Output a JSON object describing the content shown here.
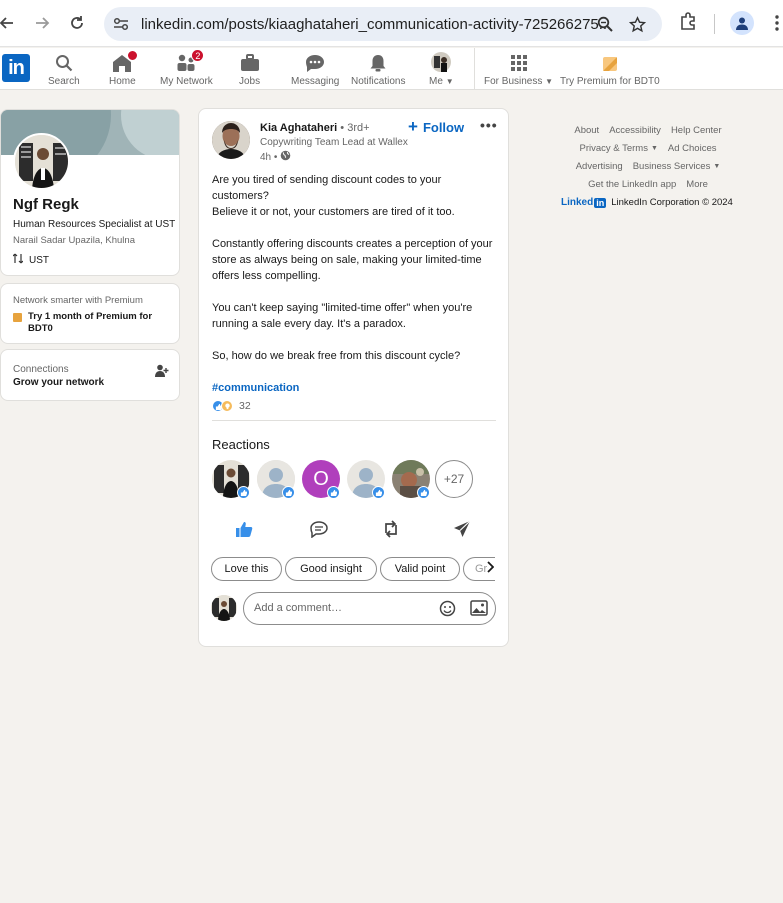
{
  "browser": {
    "url": "linkedin.com/posts/kiaaghataheri_communication-activity-725266275...",
    "icons": [
      "back-icon",
      "forward-icon",
      "reload-icon",
      "site-settings-icon",
      "zoom-icon",
      "star-icon",
      "extensions-icon",
      "profile-icon",
      "more-icon"
    ]
  },
  "nav": {
    "items": [
      {
        "label": "Search",
        "icon": "search-icon"
      },
      {
        "label": "Home",
        "icon": "home-icon"
      },
      {
        "label": "My Network",
        "icon": "network-icon",
        "badge": "2"
      },
      {
        "label": "Jobs",
        "icon": "briefcase-icon"
      },
      {
        "label": "Messaging",
        "icon": "messaging-icon"
      },
      {
        "label": "Notifications",
        "icon": "bell-icon"
      },
      {
        "label": "Me",
        "icon": "avatar"
      },
      {
        "label": "For Business",
        "icon": "grid-icon"
      },
      {
        "label": "Try Premium for BDT0",
        "icon": "premium-icon"
      }
    ]
  },
  "profile": {
    "name": "Ngf Regk",
    "title": "Human Resources Specialist at UST",
    "location": "Narail Sadar Upazila, Khulna",
    "org": "UST"
  },
  "premium": {
    "header": "Network smarter with Premium",
    "link": "Try 1 month of Premium for BDT0"
  },
  "connections": {
    "header": "Connections",
    "sub": "Grow your network"
  },
  "post": {
    "author": "Kia Aghataheri",
    "degree": "• 3rd+",
    "headline": "Copywriting Team Lead at Wallex",
    "time": "4h •",
    "follow": "Follow",
    "paragraphs": [
      "Are you tired of sending discount codes to your customers?\nBelieve it or not, your customers are tired of it too.",
      "Constantly offering discounts creates a perception of your store as always being on sale, making your limited-time offers less compelling.",
      "You can't keep saying \"limited-time offer\" when you're running a sale every day. It's a paradox.",
      "So, how do we break free from this discount cycle?"
    ],
    "hashtag": "#communication",
    "reaction_count": "32",
    "reactions_title": "Reactions",
    "more_reactors": "+27",
    "chips": [
      "Love this",
      "Good insight",
      "Valid point",
      "Gr"
    ],
    "comment_placeholder": "Add a comment…"
  },
  "footer": {
    "row1": [
      "About",
      "Accessibility",
      "Help Center"
    ],
    "row2": [
      "Privacy & Terms",
      "Ad Choices"
    ],
    "row3": [
      "Advertising",
      "Business Services"
    ],
    "row4": [
      "Get the LinkedIn app",
      "More"
    ],
    "brand_word": "Linked",
    "brand_in": "in",
    "copyright": "LinkedIn Corporation © 2024"
  },
  "colors": {
    "linkedin_blue": "#0a66c2",
    "background": "#f4f2ee",
    "notification_red": "#cb112d",
    "like_blue": "#378fe9",
    "reactor_purple": "#b03fbc"
  }
}
